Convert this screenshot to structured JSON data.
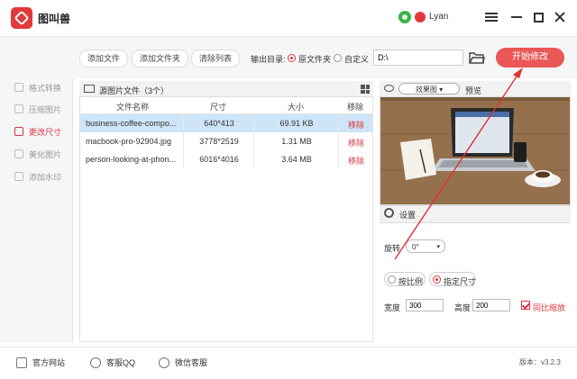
{
  "app": {
    "title": "图叫兽",
    "username": "Lyan"
  },
  "sidebar": {
    "items": [
      {
        "label": "格式转换",
        "active": false
      },
      {
        "label": "压缩图片",
        "active": false
      },
      {
        "label": "更改尺寸",
        "active": true
      },
      {
        "label": "美化图片",
        "active": false
      },
      {
        "label": "添加水印",
        "active": false
      }
    ]
  },
  "toolbar": {
    "add_file": "添加文件",
    "add_folder": "添加文件夹",
    "clear_list": "清除列表",
    "output_label": "输出目录:",
    "opt_source": "原文件夹",
    "opt_custom": "自定义",
    "path_value": "D:\\",
    "start": "开始修改"
  },
  "filelist": {
    "title": "源图片文件（3个）",
    "columns": [
      "文件名称",
      "尺寸",
      "大小",
      "移除"
    ],
    "rows": [
      {
        "name": "business-coffee-compo...",
        "size": "640*413",
        "bytes": "69.91 KB",
        "remove": "移除",
        "selected": true
      },
      {
        "name": "macbook-pro-92904.jpg",
        "size": "3778*2519",
        "bytes": "1.31 MB",
        "remove": "移除",
        "selected": false
      },
      {
        "name": "person-looking-at-phon...",
        "size": "6016*4016",
        "bytes": "3.64 MB",
        "remove": "移除",
        "selected": false
      }
    ]
  },
  "preview": {
    "mode": "效果图",
    "label": "预览"
  },
  "settings": {
    "title": "设置",
    "rotate_label": "旋转",
    "rotate_value": "0°",
    "by_ratio": "按比例",
    "by_size": "指定尺寸",
    "width_label": "宽度",
    "width_value": "300",
    "height_label": "高度",
    "height_value": "200",
    "keep_ratio": "同比缩放"
  },
  "footer": {
    "site": "官方网站",
    "qq": "客服QQ",
    "wechat": "微信客服",
    "version": "版本：v3.2.3"
  },
  "colors": {
    "accent": "#e95757",
    "selected_row": "#cde5f7",
    "remove": "#d9363e"
  }
}
